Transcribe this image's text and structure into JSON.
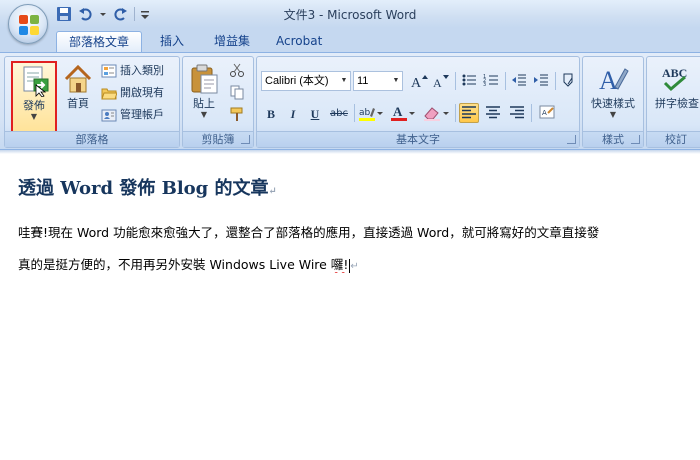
{
  "window": {
    "title": "文件3 - Microsoft Word"
  },
  "tabs": [
    {
      "label": "部落格文章",
      "active": true
    },
    {
      "label": "插入",
      "active": false
    },
    {
      "label": "增益集",
      "active": false
    },
    {
      "label": "Acrobat",
      "active": false
    }
  ],
  "ribbon": {
    "blog": {
      "label": "部落格",
      "publish_label": "發佈",
      "home_label": "首頁",
      "insert_category_label": "插入類別",
      "open_existing_label": "開啟現有",
      "manage_accounts_label": "管理帳戶"
    },
    "clipboard": {
      "label": "剪貼簿",
      "paste_label": "貼上"
    },
    "basic_text": {
      "label": "基本文字",
      "font_name": "Calibri (本文)",
      "font_size": "11",
      "bold": "B",
      "italic": "I",
      "underline": "U",
      "strike": "abc"
    },
    "styles": {
      "label": "樣式",
      "quick_styles_label": "快速樣式"
    },
    "proofing": {
      "label": "校訂",
      "spell_check_label": "拼字檢查",
      "abc_text": "ABC"
    }
  },
  "document": {
    "title": "透過 Word 發佈 Blog 的文章",
    "line1": "哇賽!現在 Word 功能愈來愈強大了，還整合了部落格的應用，直接透過 Word，就可將寫好的文章直接發",
    "line2_prefix": "真的是挺方便的，不用再另外安裝 Windows Live  Wire ",
    "line2_err": "囉!"
  },
  "colors": {
    "accent": "#15428b",
    "ribbon_bg": "#d5e3f5",
    "selected": "#ffc84a",
    "highlight_border": "#e02020"
  },
  "icons": [
    "office-button-icon",
    "save-icon",
    "undo-icon",
    "redo-icon",
    "publish-icon",
    "home-icon",
    "insert-category-icon",
    "open-existing-icon",
    "manage-accounts-icon",
    "paste-icon",
    "cut-icon",
    "copy-icon",
    "format-painter-icon",
    "grow-font-icon",
    "shrink-font-icon",
    "bullets-icon",
    "numbering-icon",
    "decrease-indent-icon",
    "increase-indent-icon",
    "clear-formatting-icon",
    "highlight-icon",
    "font-color-icon",
    "eraser-icon",
    "align-left-icon",
    "align-center-icon",
    "align-right-icon",
    "styles-icon",
    "spell-check-icon"
  ]
}
